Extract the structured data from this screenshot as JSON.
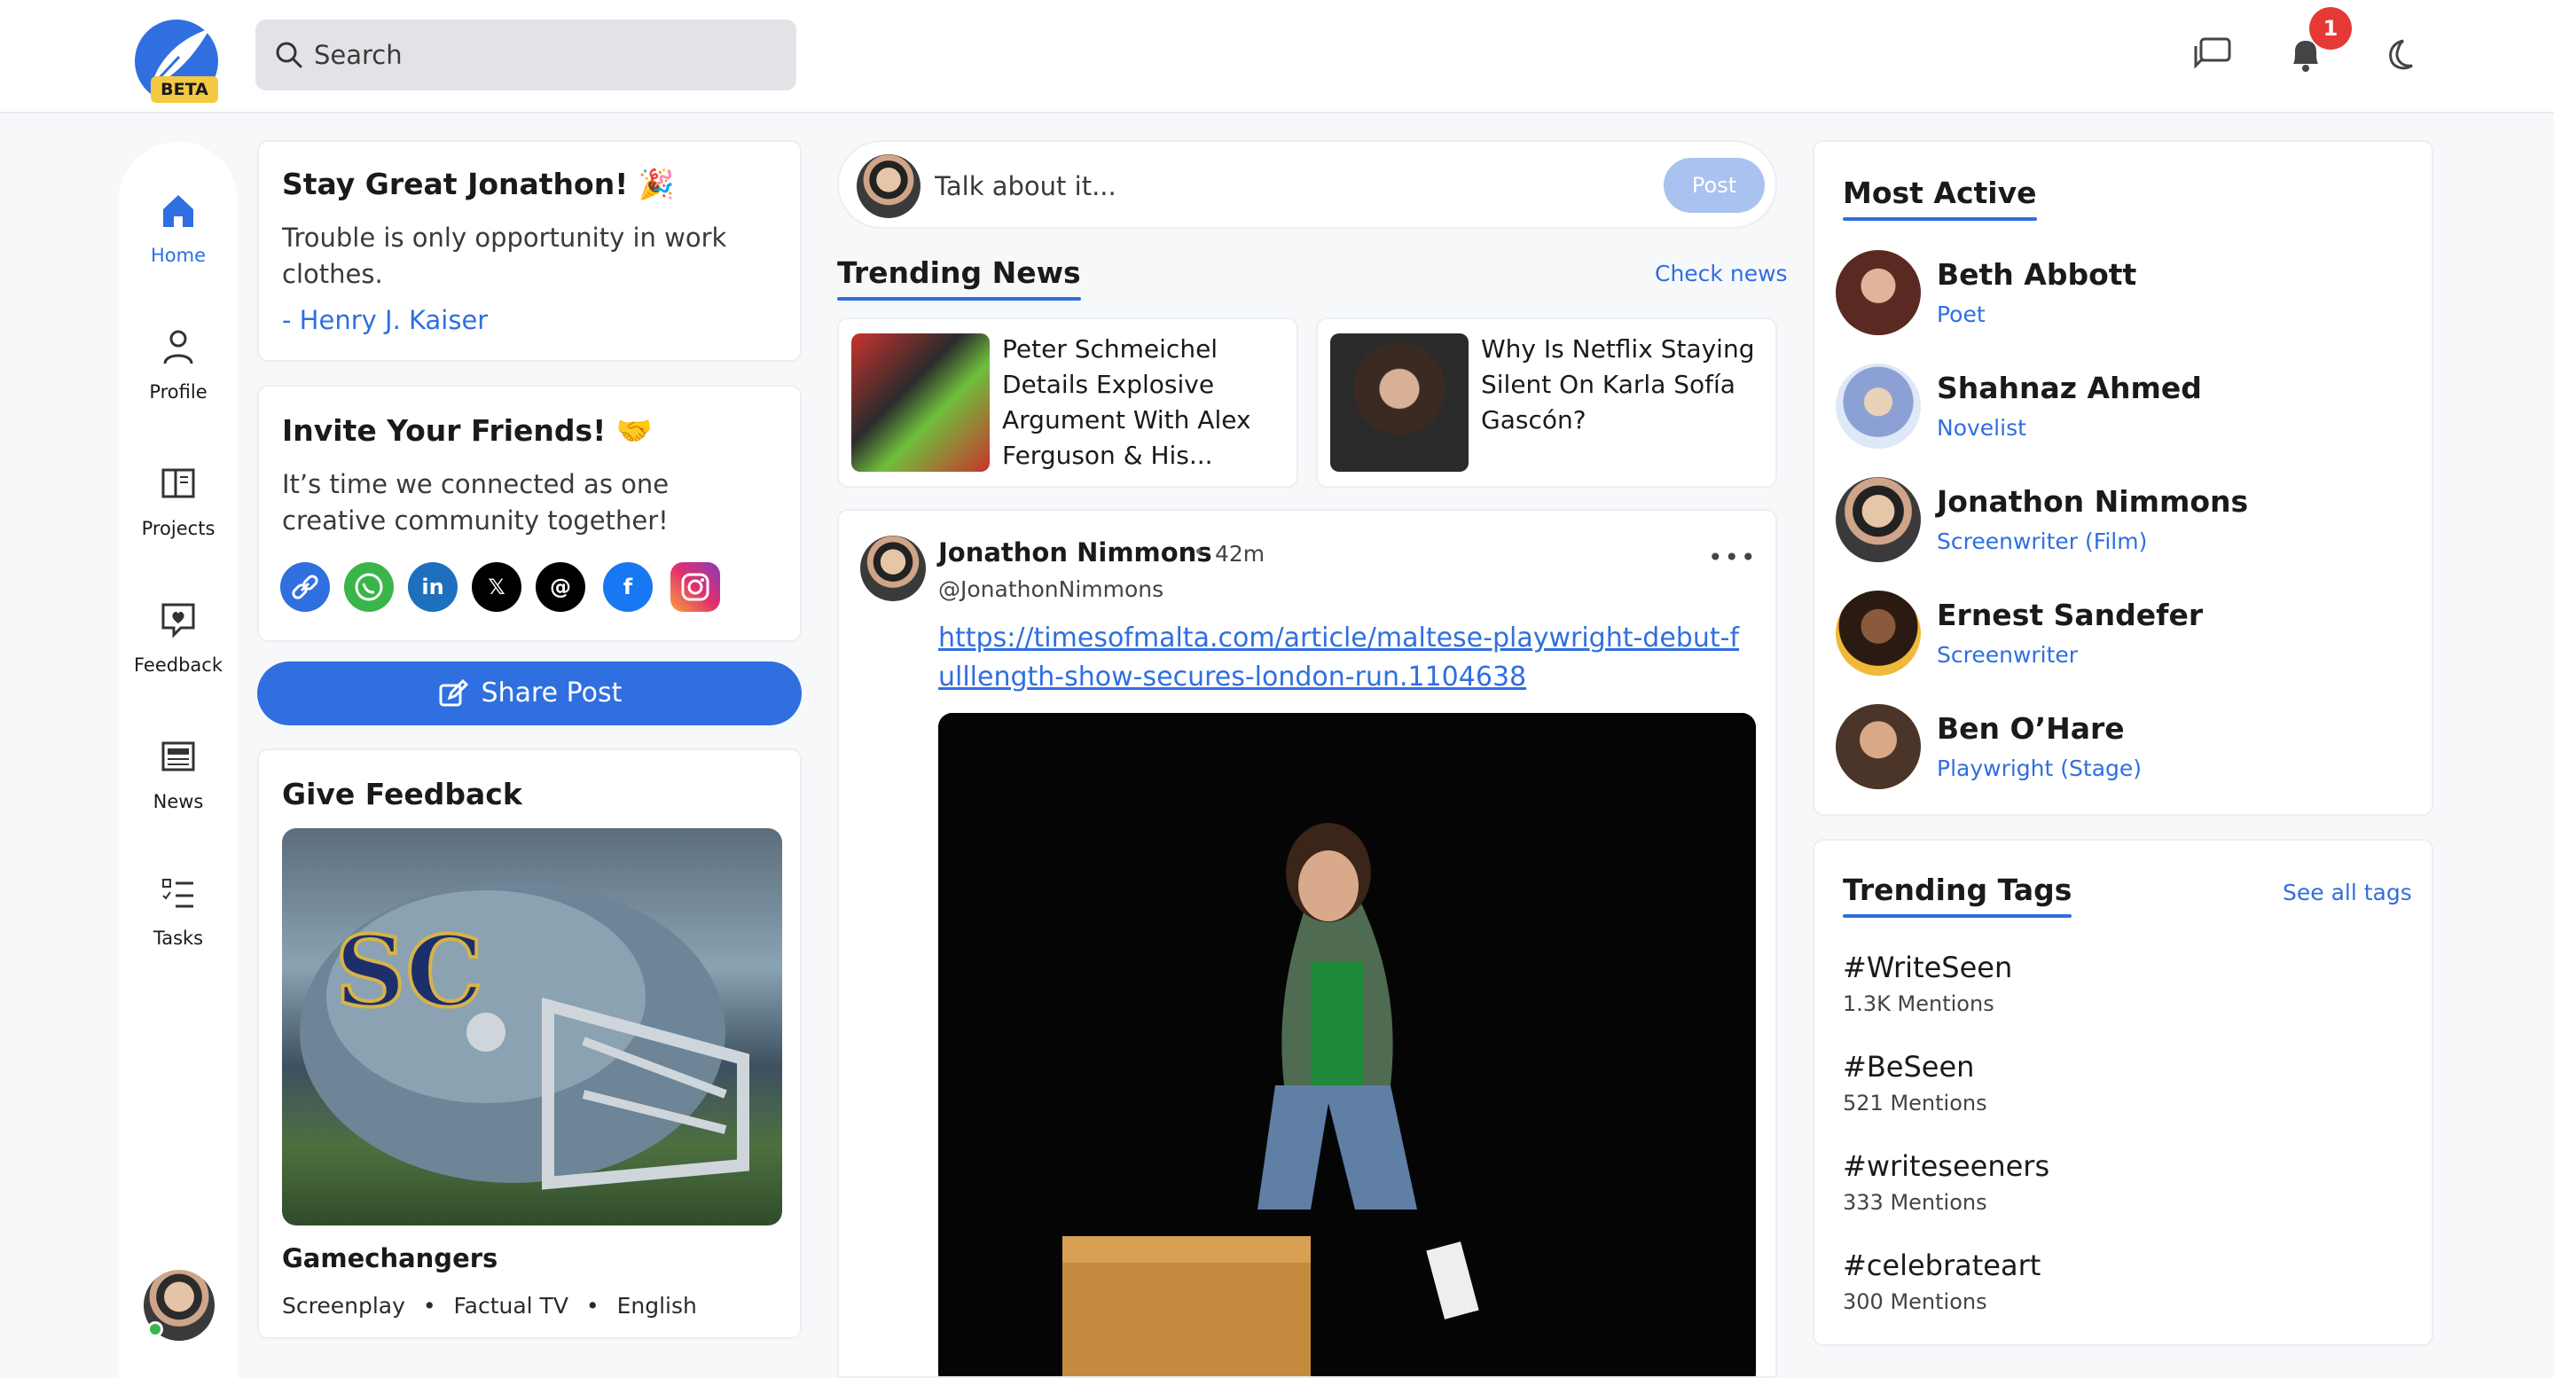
{
  "header": {
    "logo_badge": "BETA",
    "search_placeholder": "Search",
    "notification_count": "1",
    "icons": [
      "chat-icon",
      "bell-icon",
      "moon-icon"
    ]
  },
  "nav": {
    "items": [
      {
        "label": "Home",
        "icon": "home-icon",
        "active": true
      },
      {
        "label": "Profile",
        "icon": "user-icon"
      },
      {
        "label": "Projects",
        "icon": "book-icon"
      },
      {
        "label": "Feedback",
        "icon": "feedback-heart-icon"
      },
      {
        "label": "News",
        "icon": "newspaper-icon"
      },
      {
        "label": "Tasks",
        "icon": "checklist-icon"
      }
    ]
  },
  "greeting": {
    "title": "Stay Great Jonathon! 🎉",
    "quote": "Trouble is only opportunity in work clothes.",
    "author": "- Henry J. Kaiser"
  },
  "invite": {
    "title": "Invite Your Friends! 🤝",
    "text": "It’s time we connected as one creative community together!",
    "socials": [
      "link-icon",
      "whatsapp-icon",
      "linkedin-icon",
      "x-icon",
      "threads-icon",
      "facebook-icon",
      "instagram-icon"
    ]
  },
  "share_button": "Share Post",
  "feedback": {
    "title": "Give Feedback",
    "project_title": "Gamechangers",
    "meta": [
      "Screenplay",
      "Factual TV",
      "English"
    ]
  },
  "composer": {
    "placeholder": "Talk about it...",
    "post_label": "Post"
  },
  "trending_news": {
    "title": "Trending News",
    "check_link": "Check news",
    "items": [
      {
        "title": "Peter Schmeichel Details Explosive Argument With Alex Ferguson & His..."
      },
      {
        "title": "Why Is Netflix Staying Silent On Karla Sofía Gascón?"
      }
    ]
  },
  "post": {
    "author": "Jonathon Nimmons",
    "time": "42m",
    "handle": "@JonathonNimmons",
    "link": "https://timesofmalta.com/article/maltese-playwright-debut-fulllength-show-secures-london-run.1104638",
    "more": "•••"
  },
  "most_active": {
    "title": "Most Active",
    "people": [
      {
        "name": "Beth Abbott",
        "role": "Poet"
      },
      {
        "name": "Shahnaz Ahmed",
        "role": "Novelist"
      },
      {
        "name": "Jonathon Nimmons",
        "role": "Screenwriter (Film)"
      },
      {
        "name": "Ernest Sandefer",
        "role": "Screenwriter"
      },
      {
        "name": "Ben O’Hare",
        "role": "Playwright (Stage)"
      }
    ]
  },
  "trending_tags": {
    "title": "Trending Tags",
    "see_all": "See all tags",
    "tags": [
      {
        "tag": "#WriteSeen",
        "mentions": "1.3K Mentions"
      },
      {
        "tag": "#BeSeen",
        "mentions": "521 Mentions"
      },
      {
        "tag": "#writeseeners",
        "mentions": "333 Mentions"
      },
      {
        "tag": "#celebrateart",
        "mentions": "300 Mentions"
      }
    ]
  },
  "colors": {
    "accent": "#2f6fdf",
    "badge_yellow": "#f5c842",
    "notification_red": "#e53935",
    "online_green": "#3ab54a"
  }
}
